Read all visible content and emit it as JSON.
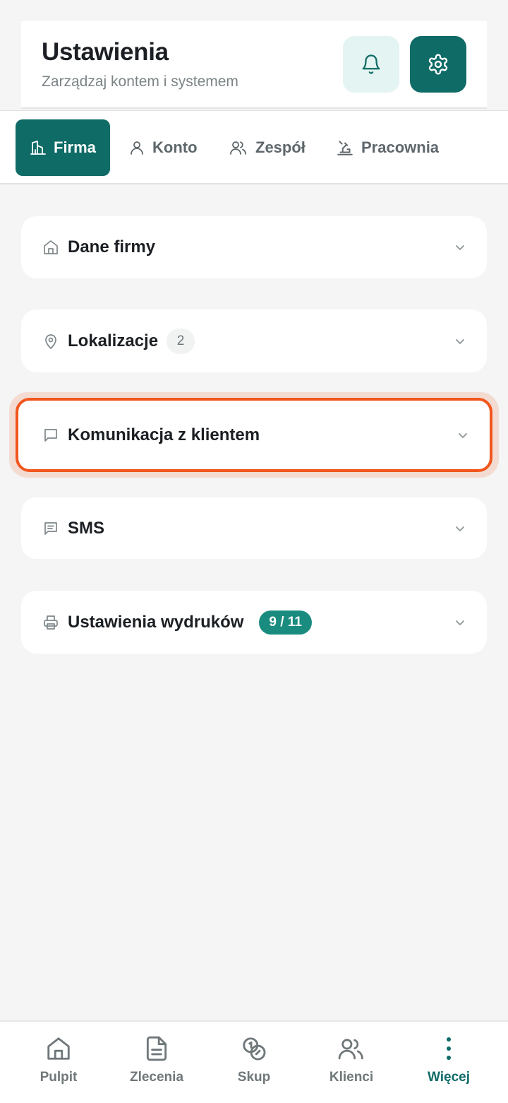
{
  "header": {
    "title": "Ustawienia",
    "subtitle": "Zarządzaj kontem i systemem",
    "bell_icon": "bell-icon",
    "gear_icon": "gear-icon"
  },
  "tabs": [
    {
      "label": "Firma",
      "icon": "building-icon",
      "active": true
    },
    {
      "label": "Konto",
      "icon": "user-icon",
      "active": false
    },
    {
      "label": "Zespół",
      "icon": "users-icon",
      "active": false
    },
    {
      "label": "Pracownia",
      "icon": "workbench-icon",
      "active": false
    }
  ],
  "sections": [
    {
      "title": "Dane firmy",
      "icon": "home-icon"
    },
    {
      "title": "Lokalizacje",
      "icon": "map-pin-icon",
      "badge": "2"
    },
    {
      "title": "Komunikacja z klientem",
      "icon": "chat-icon",
      "highlighted": true
    },
    {
      "title": "SMS",
      "icon": "message-text-icon"
    },
    {
      "title": "Ustawienia wydruków",
      "icon": "printer-icon",
      "badge": "9 / 11"
    }
  ],
  "bottom_nav": [
    {
      "label": "Pulpit",
      "icon": "home-icon"
    },
    {
      "label": "Zlecenia",
      "icon": "document-icon"
    },
    {
      "label": "Skup",
      "icon": "coins-icon"
    },
    {
      "label": "Klienci",
      "icon": "users-icon"
    },
    {
      "label": "Więcej",
      "icon": "more-vertical-icon",
      "active": true
    }
  ],
  "colors": {
    "primary": "#0f6b66",
    "primary_light": "#e4f4f2",
    "badge_accent": "#1a8b7f",
    "highlight": "#f2561d",
    "background": "#f4f5f4"
  }
}
